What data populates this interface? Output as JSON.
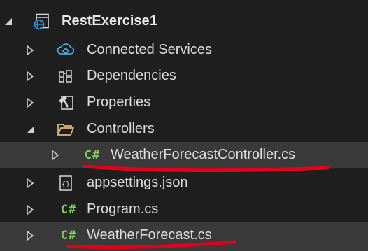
{
  "colors": {
    "background": "#1f1f1f",
    "selection": "#3a3a3a",
    "text": "#dcdcdc",
    "csharp_icon": "#7fd158",
    "annotation_underline": "#e0001b"
  },
  "project": {
    "name": "RestExercise1",
    "icon": "web-project-icon",
    "expanded": true
  },
  "items": [
    {
      "label": "Connected Services",
      "icon": "connected-services-icon",
      "expanded": false
    },
    {
      "label": "Dependencies",
      "icon": "dependencies-icon",
      "expanded": false
    },
    {
      "label": "Properties",
      "icon": "properties-wrench-icon",
      "expanded": false
    },
    {
      "label": "Controllers",
      "icon": "folder-open-icon",
      "expanded": true,
      "children": [
        {
          "label": "WeatherForecastController.cs",
          "icon_text": "C#",
          "icon": "csharp-file-icon",
          "selected": true,
          "annotated": true
        }
      ]
    },
    {
      "label": "appsettings.json",
      "icon": "json-file-icon",
      "expanded": false
    },
    {
      "label": "Program.cs",
      "icon_text": "C#",
      "icon": "csharp-file-icon",
      "expanded": false
    },
    {
      "label": "WeatherForecast.cs",
      "icon_text": "C#",
      "icon": "csharp-file-icon",
      "expanded": false,
      "selected": true,
      "annotated": true
    }
  ]
}
